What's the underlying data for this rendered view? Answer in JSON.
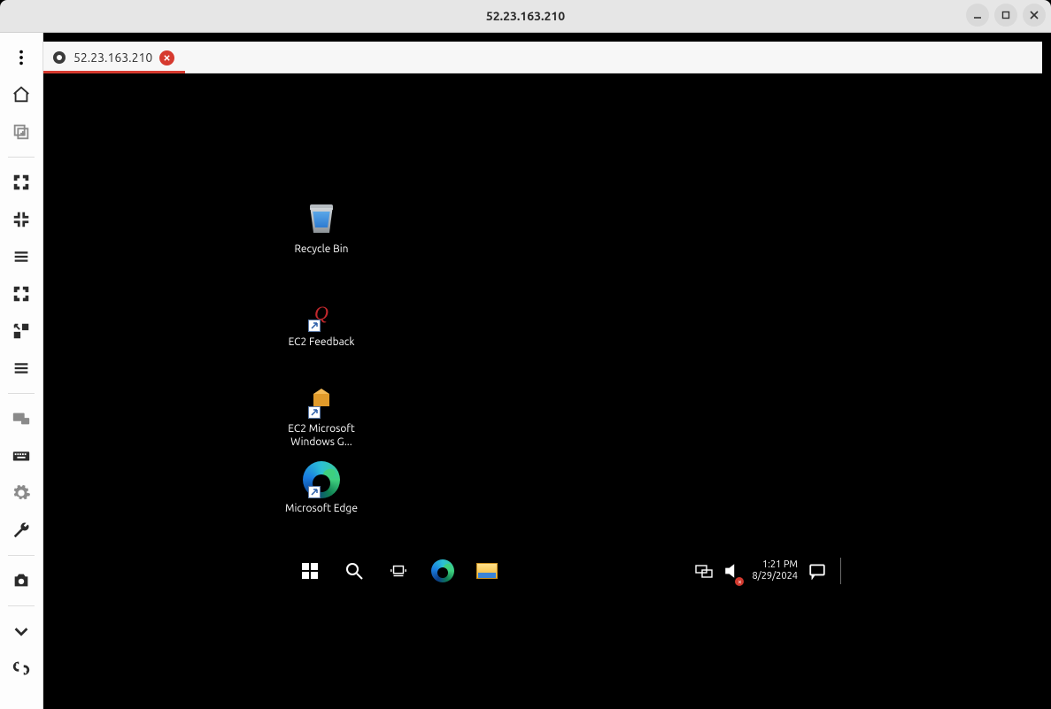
{
  "window": {
    "title": "52.23.163.210"
  },
  "tab": {
    "label": "52.23.163.210"
  },
  "desktop_icons": {
    "recycle_bin": "Recycle Bin",
    "ec2_feedback": "EC2 Feedback",
    "ec2_ms_guide": "EC2 Microsoft Windows G...",
    "edge": "Microsoft Edge"
  },
  "taskbar": {
    "time": "1:21 PM",
    "date": "8/29/2024"
  }
}
